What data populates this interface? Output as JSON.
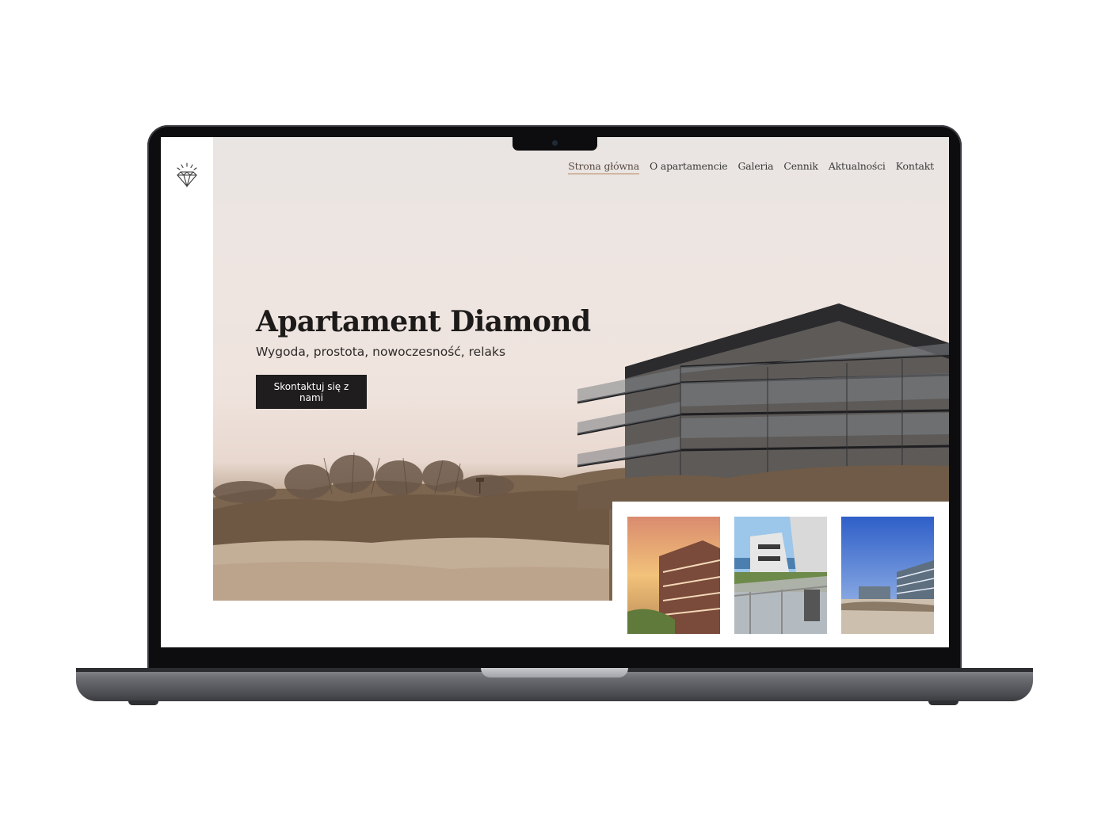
{
  "site": {
    "logo_icon": "diamond-icon",
    "nav": [
      {
        "label": "Strona główna",
        "active": true
      },
      {
        "label": "O apartamencie",
        "active": false
      },
      {
        "label": "Galeria",
        "active": false
      },
      {
        "label": "Cennik",
        "active": false
      },
      {
        "label": "Aktualności",
        "active": false
      },
      {
        "label": "Kontakt",
        "active": false
      }
    ],
    "hero": {
      "title": "Apartament Diamond",
      "subtitle": "Wygoda, prostota, nowoczesność, relaks",
      "cta_label": "Skontaktuj się z nami"
    },
    "gallery": [
      {
        "name": "sunset-building-photo"
      },
      {
        "name": "balcony-sea-view-photo"
      },
      {
        "name": "blue-sky-buildings-photo"
      }
    ]
  },
  "colors": {
    "accent_underline": "#b5805a",
    "button_bg": "#1f1d1d",
    "text_dark": "#1d1b1a"
  }
}
